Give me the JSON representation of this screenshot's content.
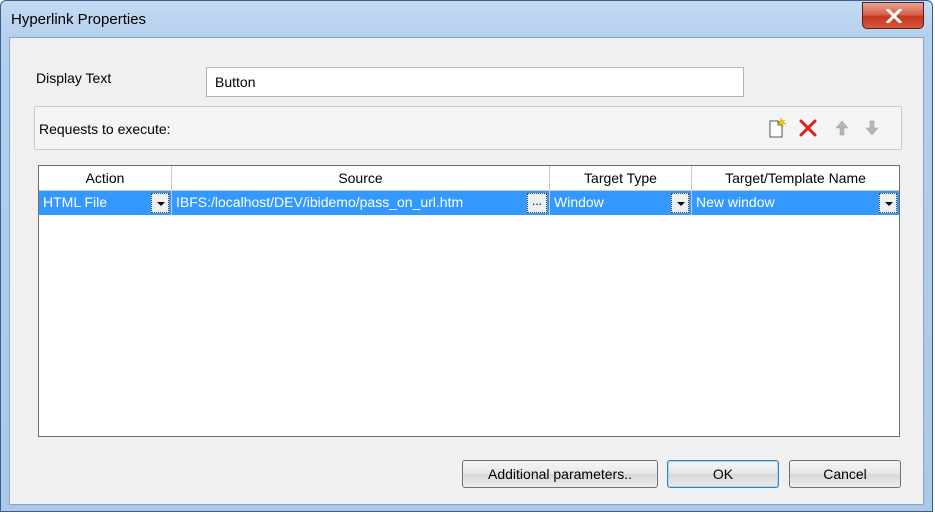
{
  "window": {
    "title": "Hyperlink Properties"
  },
  "form": {
    "display_text_label": "Display Text",
    "display_text_value": "Button",
    "requests_label": "Requests to execute:",
    "toolbar_icons": [
      "new-request-icon",
      "delete-icon",
      "move-up-icon",
      "move-down-icon"
    ]
  },
  "table": {
    "columns": [
      "Action",
      "Source",
      "Target Type",
      "Target/Template Name"
    ],
    "rows": [
      {
        "action": "HTML File",
        "source": "IBFS:/localhost/DEV/ibidemo/pass_on_url.htm",
        "source_button": "...",
        "target_type": "Window",
        "target_name": "New window"
      }
    ]
  },
  "buttons": {
    "additional": "Additional parameters..",
    "ok": "OK",
    "cancel": "Cancel"
  },
  "colors": {
    "selection": "#3399ff",
    "delete_icon": "#e02020",
    "close_button": "#c4381f"
  }
}
